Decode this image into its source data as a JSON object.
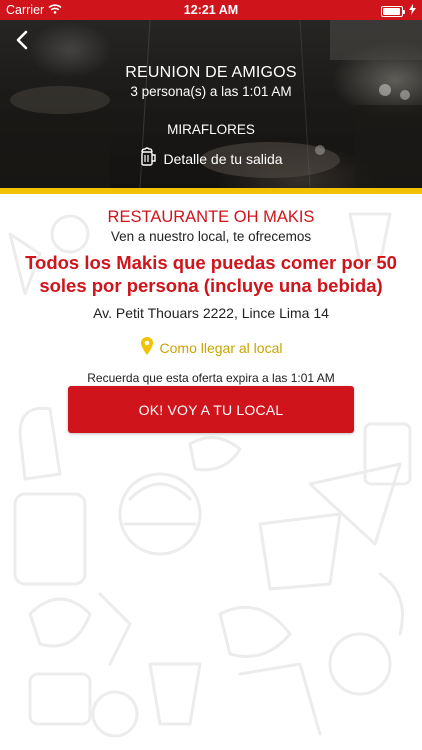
{
  "status_bar": {
    "carrier": "Carrier",
    "time": "12:21 AM"
  },
  "hero": {
    "title": "REUNION DE AMIGOS",
    "subtitle": "3 persona(s) a las 1:01 AM",
    "district": "MIRAFLORES",
    "detail_label": "Detalle de tu salida"
  },
  "offer": {
    "restaurant_name": "RESTAURANTE OH MAKIS",
    "intro": "Ven a nuestro local, te ofrecemos",
    "description": "Todos los Makis que puedas comer por 50 soles por persona (incluye una bebida)",
    "address": "Av. Petit Thouars 2222, Lince Lima 14",
    "directions_label": "Como llegar al local",
    "expiry_note": "Recuerda que esta oferta expira a las 1:01 AM",
    "cta_label": "OK! VOY A TU LOCAL"
  },
  "colors": {
    "brand_red": "#d0141b",
    "accent_yellow": "#f2c200",
    "directions_gold": "#c9a400"
  },
  "icons": {
    "back": "chevron-left-icon",
    "wifi": "wifi-icon",
    "battery": "battery-icon",
    "charging": "bolt-icon",
    "detail": "beer-mug-icon",
    "location": "map-pin-icon"
  }
}
